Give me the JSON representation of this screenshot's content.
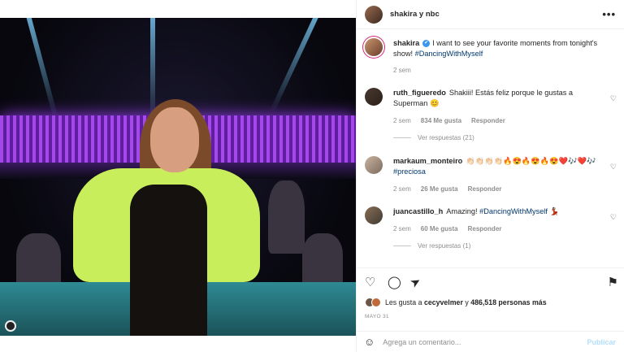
{
  "header": {
    "title": "shakira y nbc",
    "more": "•••"
  },
  "caption": {
    "user": "shakira",
    "verified": "✔",
    "text": "I want to see your favorite moments from tonight's show!",
    "tag": "#DancingWithMyself",
    "time": "2 sem"
  },
  "comments": [
    {
      "user": "ruth_figueredo",
      "text": "Shakiii! Estás feliz porque le gustas a Superman 😊",
      "time": "2 sem",
      "likes": "834 Me gusta",
      "reply": "Responder",
      "replies": "Ver respuestas (21)"
    },
    {
      "user": "markaum_monteiro",
      "text": "👏🏻👏🏻👏🏻👏🏻🔥😍🔥😍🔥😍❤️🎶❤️🎶",
      "tag": "#preciosa",
      "time": "2 sem",
      "likes": "26 Me gusta",
      "reply": "Responder"
    },
    {
      "user": "juancastillo_h",
      "text": "Amazing!",
      "tag": "#DancingWithMyself",
      "tail": "💃🏽",
      "time": "2 sem",
      "likes": "60 Me gusta",
      "reply": "Responder",
      "replies": "Ver respuestas (1)"
    }
  ],
  "actions": {
    "like": "♡",
    "comment": "◯",
    "share": "➤",
    "save": "⚑",
    "likes_prefix": "Les gusta a",
    "likes_user": "cecyvelmer",
    "likes_middle": "y",
    "likes_count": "486,518 personas más",
    "date": "MAYO 31"
  },
  "composer": {
    "smile": "☺",
    "placeholder": "Agrega un comentario...",
    "post": "Publicar"
  }
}
